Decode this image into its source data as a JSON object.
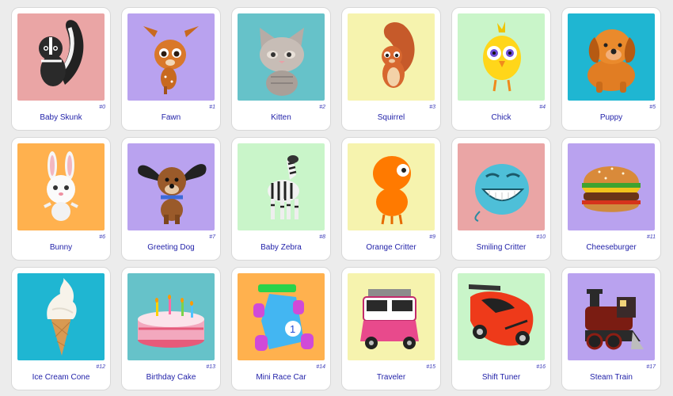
{
  "colors": {
    "pink": "#eaa5a5",
    "purple": "#b9a2ef",
    "teal": "#66c2c9",
    "yellow": "#f6f3ae",
    "green": "#c9f5c9",
    "cyan": "#1fb6d2",
    "orange": "#ffb14e",
    "label": "#1f1fa8"
  },
  "items": [
    {
      "label": "Baby Skunk",
      "index": "#0",
      "bg": "#eaa5a5",
      "icon": "skunk-icon"
    },
    {
      "label": "Fawn",
      "index": "#1",
      "bg": "#b9a2ef",
      "icon": "fawn-icon"
    },
    {
      "label": "Kitten",
      "index": "#2",
      "bg": "#66c2c9",
      "icon": "kitten-icon"
    },
    {
      "label": "Squirrel",
      "index": "#3",
      "bg": "#f6f3ae",
      "icon": "squirrel-icon"
    },
    {
      "label": "Chick",
      "index": "#4",
      "bg": "#c9f5c9",
      "icon": "chick-icon"
    },
    {
      "label": "Puppy",
      "index": "#5",
      "bg": "#1fb6d2",
      "icon": "puppy-icon"
    },
    {
      "label": "Bunny",
      "index": "#6",
      "bg": "#ffb14e",
      "icon": "bunny-icon"
    },
    {
      "label": "Greeting Dog",
      "index": "#7",
      "bg": "#b9a2ef",
      "icon": "dog-icon"
    },
    {
      "label": "Baby Zebra",
      "index": "#8",
      "bg": "#c9f5c9",
      "icon": "zebra-icon"
    },
    {
      "label": "Orange Critter",
      "index": "#9",
      "bg": "#f6f3ae",
      "icon": "orange-critter-icon"
    },
    {
      "label": "Smiling Critter",
      "index": "#10",
      "bg": "#eaa5a5",
      "icon": "smiling-critter-icon"
    },
    {
      "label": "Cheeseburger",
      "index": "#11",
      "bg": "#b9a2ef",
      "icon": "cheeseburger-icon"
    },
    {
      "label": "Ice Cream Cone",
      "index": "#12",
      "bg": "#1fb6d2",
      "icon": "ice-cream-icon"
    },
    {
      "label": "Birthday Cake",
      "index": "#13",
      "bg": "#66c2c9",
      "icon": "cake-icon"
    },
    {
      "label": "Mini Race Car",
      "index": "#14",
      "bg": "#ffb14e",
      "icon": "race-car-icon"
    },
    {
      "label": "Traveler",
      "index": "#15",
      "bg": "#f6f3ae",
      "icon": "van-icon"
    },
    {
      "label": "Shift Tuner",
      "index": "#16",
      "bg": "#c9f5c9",
      "icon": "sports-car-icon"
    },
    {
      "label": "Steam Train",
      "index": "#17",
      "bg": "#b9a2ef",
      "icon": "train-icon"
    }
  ]
}
